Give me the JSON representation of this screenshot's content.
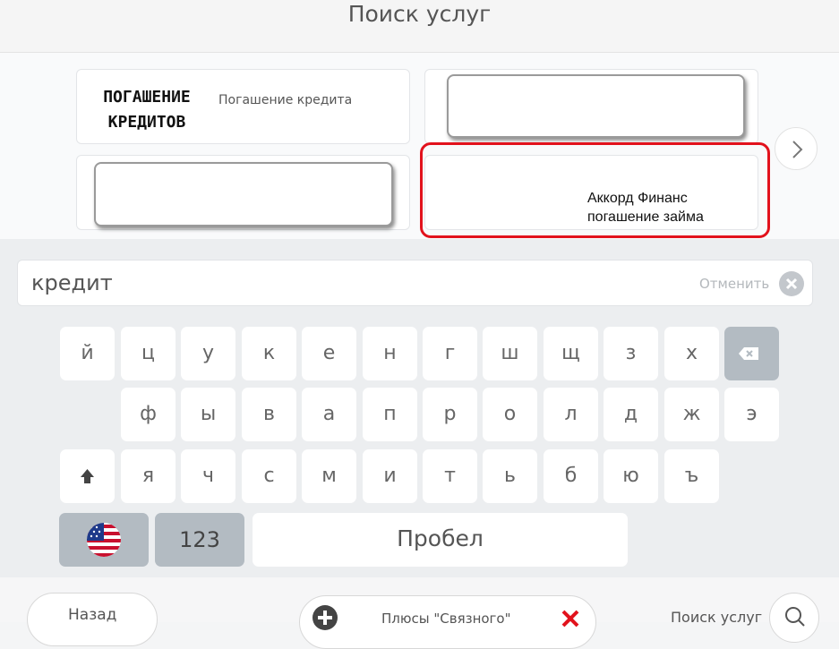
{
  "header": {
    "title": "Поиск услуг"
  },
  "results": {
    "card1": {
      "logo_line1": "ПОГАШЕНИЕ",
      "logo_line2": "КРЕДИТОВ",
      "label": "Погашение кредита"
    },
    "card4": {
      "line1": "Аккорд Финанс",
      "line2": "погашение займа"
    }
  },
  "search": {
    "value": "кредит",
    "cancel_label": "Отменить"
  },
  "keyboard": {
    "row1": [
      "й",
      "ц",
      "у",
      "к",
      "е",
      "н",
      "г",
      "ш",
      "щ",
      "з",
      "х"
    ],
    "row2": [
      "ф",
      "ы",
      "в",
      "а",
      "п",
      "р",
      "о",
      "л",
      "д",
      "ж",
      "э"
    ],
    "row3": [
      "я",
      "ч",
      "с",
      "м",
      "и",
      "т",
      "ь",
      "б",
      "ю",
      "ъ"
    ],
    "numbers_label": "123",
    "space_label": "Пробел"
  },
  "footer": {
    "back_label": "Назад",
    "pluses_label": "Плюсы \"Связного\"",
    "search_label": "Поиск услуг"
  },
  "colors": {
    "highlight": "#e2121c",
    "grey_key": "#b3bbc2"
  }
}
